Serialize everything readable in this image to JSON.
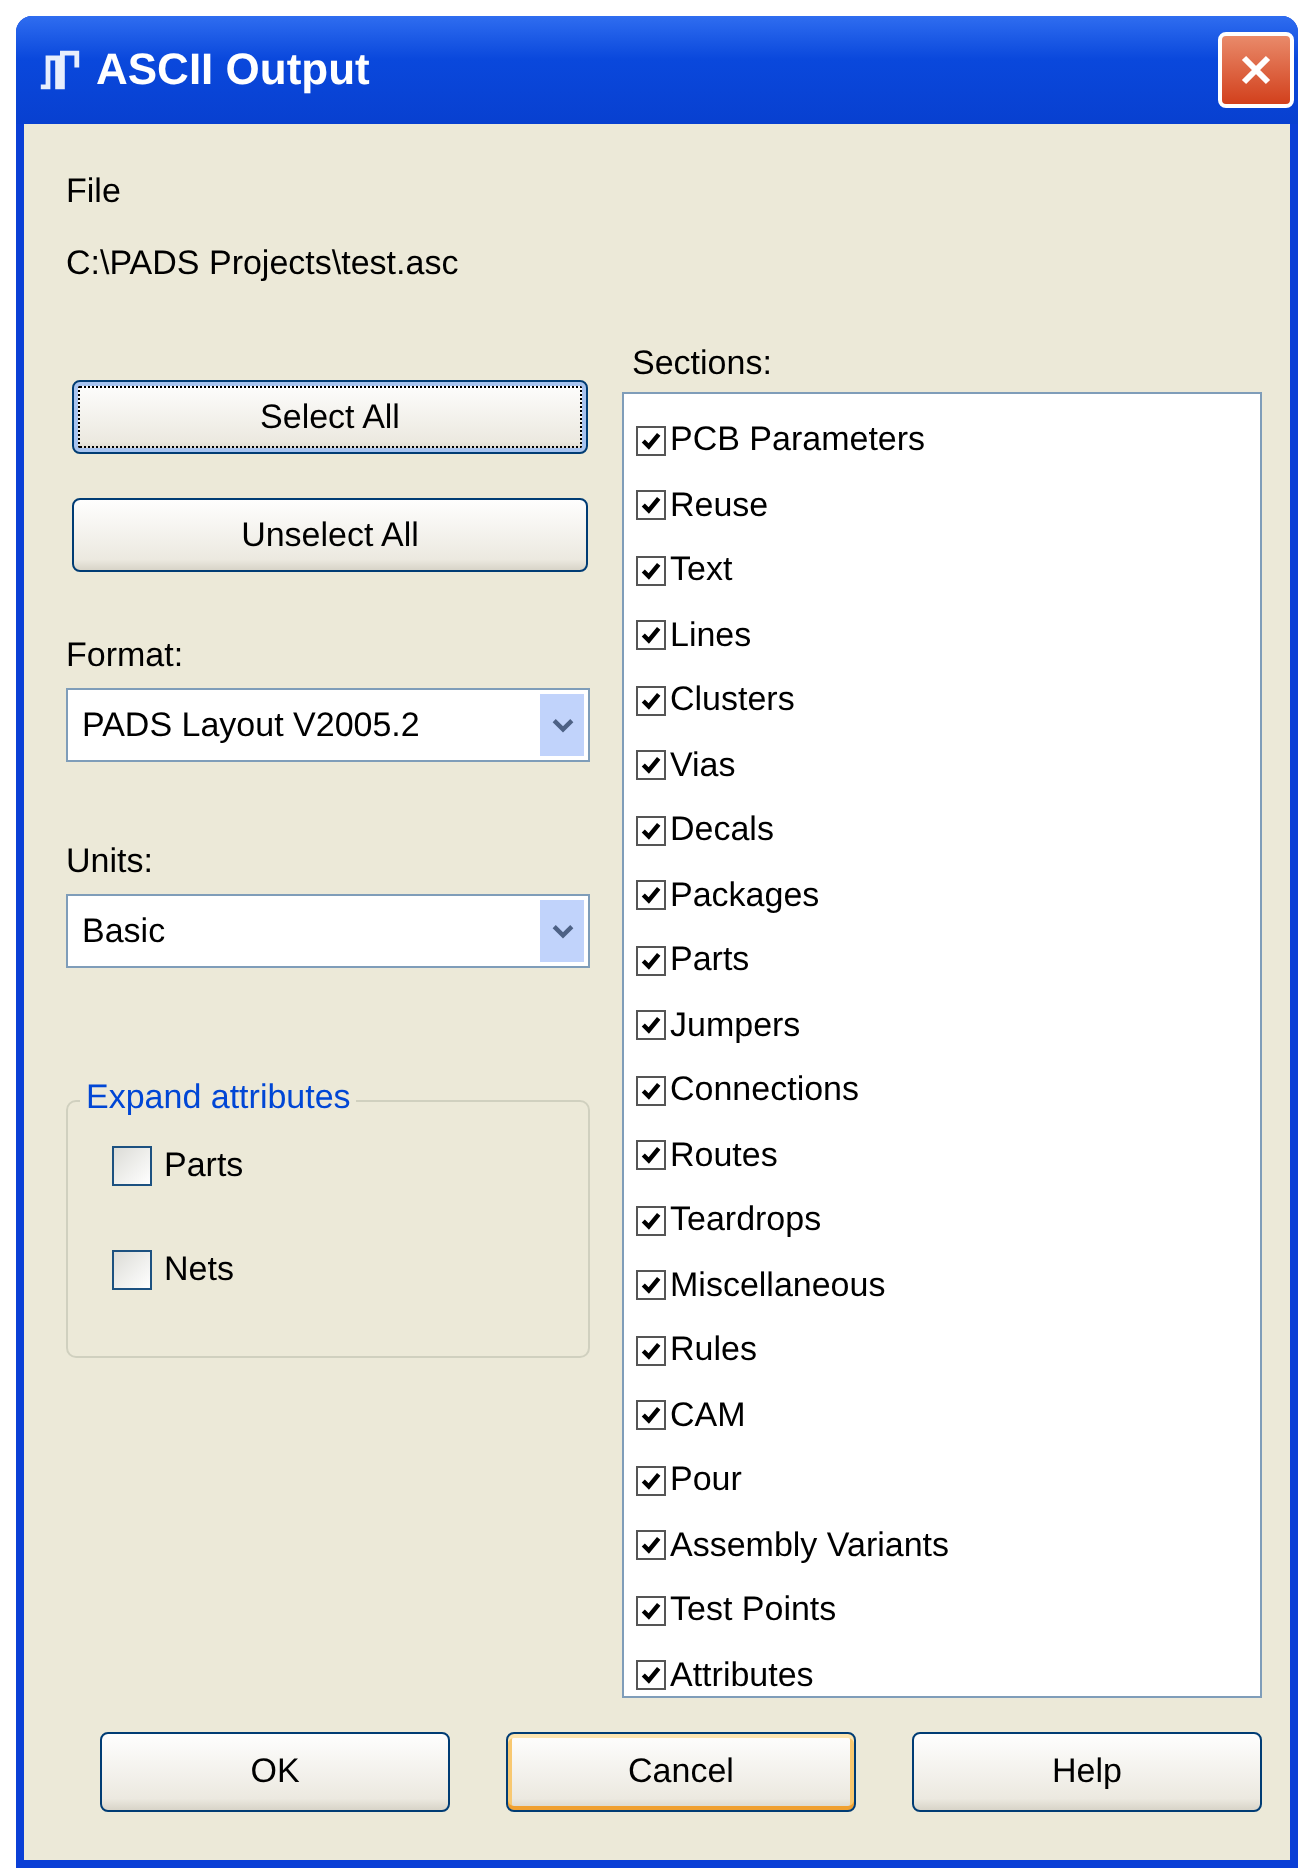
{
  "window": {
    "title": "ASCII Output"
  },
  "file": {
    "label": "File",
    "path": "C:\\PADS Projects\\test.asc"
  },
  "select_buttons": [
    {
      "label": "Select All",
      "focused": true
    },
    {
      "label": "Unselect All",
      "focused": false
    }
  ],
  "format": {
    "label": "Format:",
    "value": "PADS Layout V2005.2"
  },
  "units": {
    "label": "Units:",
    "value": "Basic"
  },
  "expand_attributes": {
    "title": "Expand attributes",
    "options": [
      {
        "label": "Parts",
        "checked": false
      },
      {
        "label": "Nets",
        "checked": false
      }
    ]
  },
  "sections": {
    "label": "Sections:",
    "items": [
      {
        "label": "PCB Parameters",
        "checked": true
      },
      {
        "label": "Reuse",
        "checked": true
      },
      {
        "label": "Text",
        "checked": true
      },
      {
        "label": "Lines",
        "checked": true
      },
      {
        "label": "Clusters",
        "checked": true
      },
      {
        "label": "Vias",
        "checked": true
      },
      {
        "label": "Decals",
        "checked": true
      },
      {
        "label": "Packages",
        "checked": true
      },
      {
        "label": "Parts",
        "checked": true
      },
      {
        "label": "Jumpers",
        "checked": true
      },
      {
        "label": "Connections",
        "checked": true
      },
      {
        "label": "Routes",
        "checked": true
      },
      {
        "label": "Teardrops",
        "checked": true
      },
      {
        "label": "Miscellaneous",
        "checked": true
      },
      {
        "label": "Rules",
        "checked": true
      },
      {
        "label": "CAM",
        "checked": true
      },
      {
        "label": "Pour",
        "checked": true
      },
      {
        "label": "Assembly Variants",
        "checked": true
      },
      {
        "label": "Test Points",
        "checked": true
      },
      {
        "label": "Attributes",
        "checked": true
      }
    ]
  },
  "buttons": [
    {
      "label": "OK",
      "default": false
    },
    {
      "label": "Cancel",
      "default": true
    },
    {
      "label": "Help",
      "default": false
    }
  ]
}
